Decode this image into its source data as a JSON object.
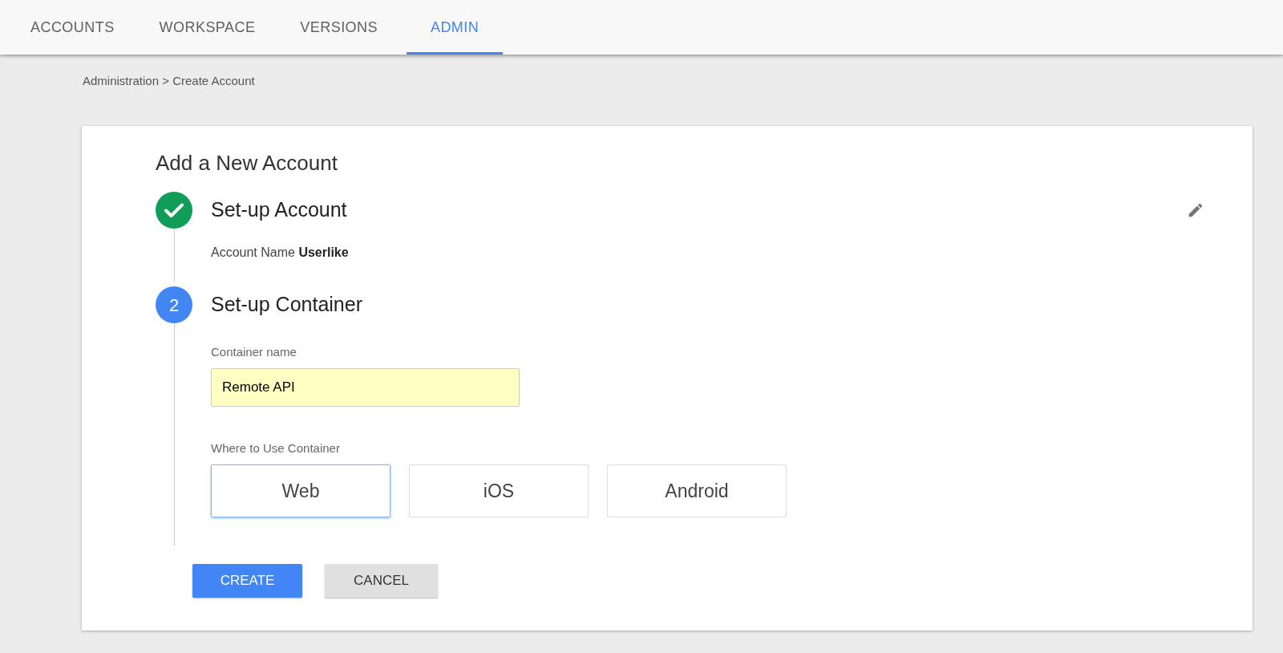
{
  "tabs": [
    {
      "label": "ACCOUNTS",
      "selected": false
    },
    {
      "label": "WORKSPACE",
      "selected": false
    },
    {
      "label": "VERSIONS",
      "selected": false
    },
    {
      "label": "ADMIN",
      "selected": true
    }
  ],
  "breadcrumb": "Administration > Create Account",
  "title": "Add a New Account",
  "steps": [
    {
      "kind": "done",
      "label": "Set-up Account",
      "summary_label": "Account Name",
      "summary_value": "Userlike"
    },
    {
      "kind": "active",
      "number": "2",
      "label": "Set-up Container"
    }
  ],
  "container_name": {
    "label": "Container name",
    "value": "Remote API"
  },
  "where_to_use": {
    "label": "Where to Use Container",
    "options": [
      {
        "label": "Web",
        "selected": true
      },
      {
        "label": "iOS",
        "selected": false
      },
      {
        "label": "Android",
        "selected": false
      }
    ]
  },
  "buttons": [
    {
      "label": "CREATE",
      "kind": "primary"
    },
    {
      "label": "CANCEL",
      "kind": "secondary"
    }
  ]
}
